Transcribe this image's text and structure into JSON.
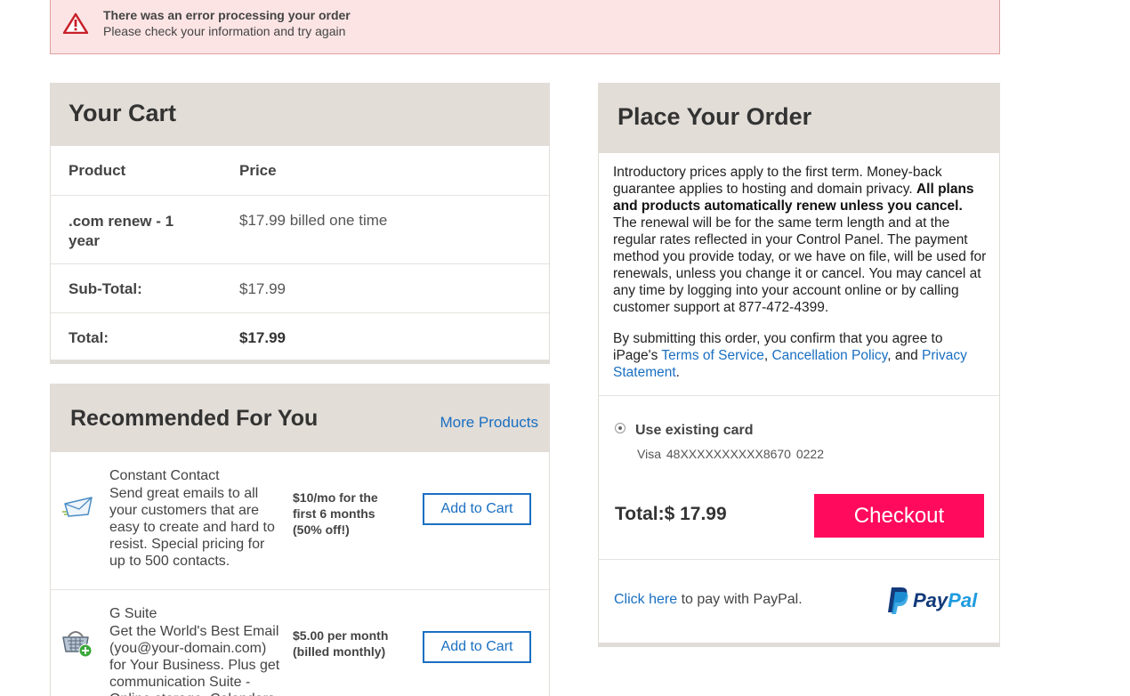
{
  "error": {
    "title": "There was an error processing your order",
    "message": "Please check your information and try again",
    "color": "#c8202a"
  },
  "cart": {
    "title": "Your Cart",
    "headers": {
      "product": "Product",
      "price": "Price"
    },
    "items": [
      {
        "product": ".com renew - 1 year",
        "price": "$17.99 billed one time"
      }
    ],
    "subtotal_label": "Sub-Total:",
    "subtotal_value": "$17.99",
    "total_label": "Total:",
    "total_value": "$17.99"
  },
  "recommended": {
    "title": "Recommended For You",
    "more_link": "More Products",
    "items": [
      {
        "name": "Constant Contact",
        "description": "Send great emails to all your customers that are easy to create and hard to resist. Special pricing for up to 500 contacts.",
        "price": "$10/mo for the first 6 months (50% off!)",
        "button": "Add to Cart",
        "icon": "envelope-icon"
      },
      {
        "name": "G Suite",
        "description": "Get the World's Best Email (you@your-domain.com) for Your Business. Plus get communication Suite - Online storage, Calendars",
        "price": "$5.00 per month (billed monthly)",
        "button": "Add to Cart",
        "icon": "basket-add-icon"
      }
    ]
  },
  "order": {
    "title": "Place Your Order",
    "terms_intro": "Introductory prices apply to the first term. Money-back guarantee applies to hosting and domain privacy.",
    "terms_bold": "All plans and products automatically renew unless you cancel.",
    "terms_rest": "The renewal will be for the same term length and at the regular rates reflected in your Control Panel. The payment method you provide today, or we have on file, will be used for renewals, unless you change it or cancel. You may cancel at any time by logging into your account online or by calling customer support at 877-472-4399.",
    "agree_prefix": "By submitting this order, you confirm that you agree to iPage's",
    "terms_of_service": "Terms of Service",
    "comma": ",",
    "cancellation_policy": "Cancellation Policy",
    "and_text": ", and",
    "privacy_statement": "Privacy Statement",
    "period": ".",
    "payment_option": "Use existing card",
    "card_info": "Visa  48XXXXXXXXXX8670  0222",
    "total": "Total:$ 17.99",
    "checkout_button": "Checkout",
    "paypal_link": "Click here",
    "paypal_text": "to pay with PayPal.",
    "paypal_logo_pay": "Pay",
    "paypal_logo_pal": "Pal",
    "colors": {
      "checkout": "#ff0a5c",
      "link": "#1a6fc2"
    }
  }
}
